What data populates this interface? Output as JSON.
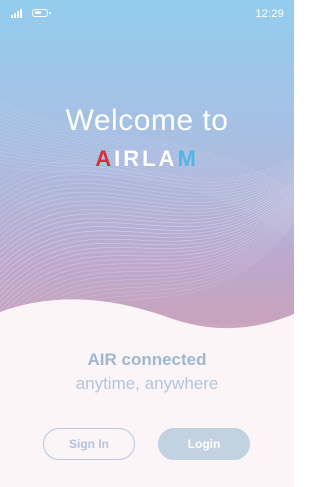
{
  "status_bar": {
    "time": "12:29",
    "signal_icon": "signal-bars-icon",
    "battery_icon": "battery-icon"
  },
  "hero": {
    "welcome_text": "Welcome to",
    "brand": {
      "letter_a": "A",
      "middle": "IRLA",
      "letter_m": "M",
      "accent_red": "#d92d3b",
      "accent_blue": "#4fb6e4"
    }
  },
  "tagline": {
    "strong": "AIR connected",
    "sub": "anytime, anywhere"
  },
  "buttons": {
    "sign_in": "Sign In",
    "login": "Login"
  },
  "colors": {
    "gradient_top": "#93cdee",
    "gradient_bottom": "#c8a3bd",
    "tagline": "#9fb7cf",
    "button_fill": "#c3d2e0"
  }
}
